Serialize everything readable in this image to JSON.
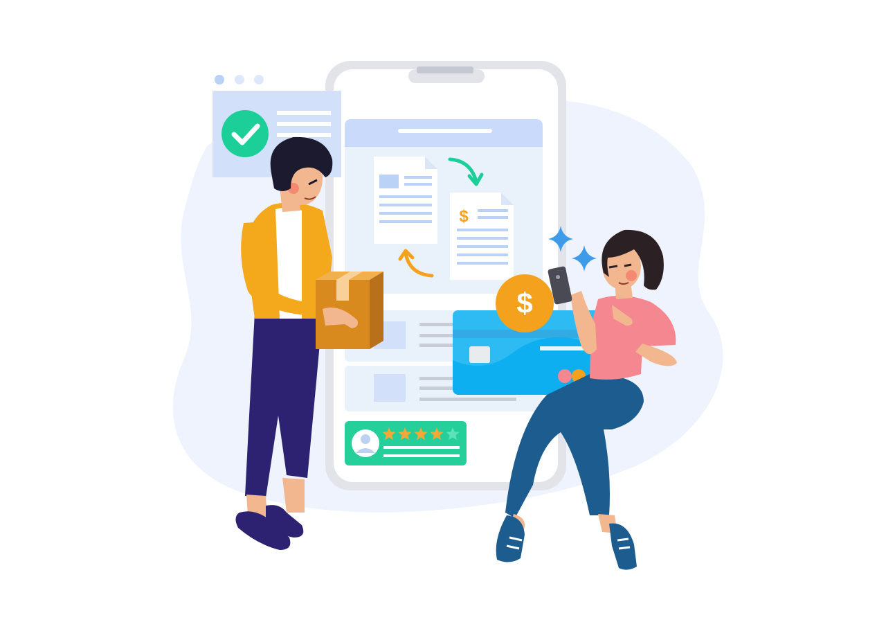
{
  "illustration": {
    "currency_symbol": "$",
    "rating": {
      "filled": 4,
      "total": 5
    },
    "icons": [
      "checkmark-icon",
      "document-icon",
      "invoice-icon",
      "dollar-coin-icon",
      "credit-card-icon",
      "smartphone-icon",
      "star-icon",
      "avatar-icon",
      "sparkle-icon",
      "package-box-icon"
    ],
    "colors": {
      "background_blob": "#eef3fd",
      "phone_frame": "#e2e4ea",
      "screen_header": "#c9dafb",
      "screen_panel": "#e9f1fb",
      "check_green": "#1ccf99",
      "coin_orange": "#f4a21d",
      "card_blue": "#2aa9ea",
      "review_green": "#25cf9a",
      "star_orange": "#f4a835",
      "jacket_yellow": "#f4a81c",
      "pants_navy": "#2d2272",
      "shirt_pink": "#f4878f",
      "jeans_blue": "#1d5c8e",
      "box_brown": "#d88a1e",
      "sparkle_blue": "#3d9be9"
    }
  }
}
